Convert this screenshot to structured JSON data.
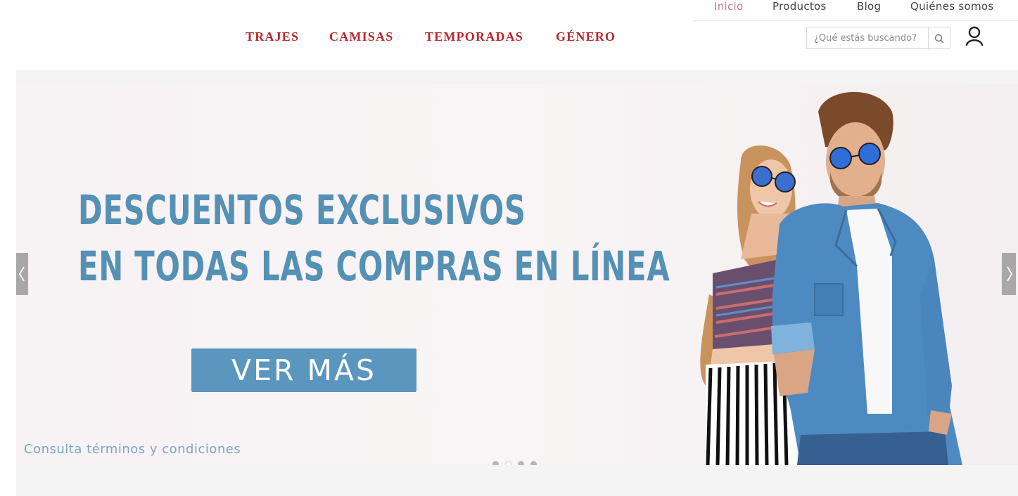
{
  "top_nav": [
    {
      "label": "Inicio",
      "active": true
    },
    {
      "label": "Productos",
      "active": false
    },
    {
      "label": "Blog",
      "active": false
    },
    {
      "label": "Quiénes somos",
      "active": false
    }
  ],
  "main_nav": [
    "TRAJES",
    "CAMISAS",
    "TEMPORADAS",
    "GÉNERO"
  ],
  "search": {
    "placeholder": "¿Qué estás buscando?",
    "icon": "search-icon"
  },
  "account": {
    "icon": "user-icon"
  },
  "hero": {
    "headline_line1": "DESCUENTOS EXCLUSIVOS",
    "headline_line2": "EN TODAS LAS COMPRAS EN LÍNEA",
    "cta_label": "VER MÁS",
    "terms_link": "Consulta términos y condiciones"
  },
  "carousel": {
    "slide_count": 4,
    "active_index": 1,
    "prev_icon": "chevron-left-icon",
    "next_icon": "chevron-right-icon"
  },
  "colors": {
    "nav_red": "#b8262d",
    "active_link": "#c97b84",
    "hero_blue": "#5590b5",
    "cta_blue": "#5a96bd"
  }
}
